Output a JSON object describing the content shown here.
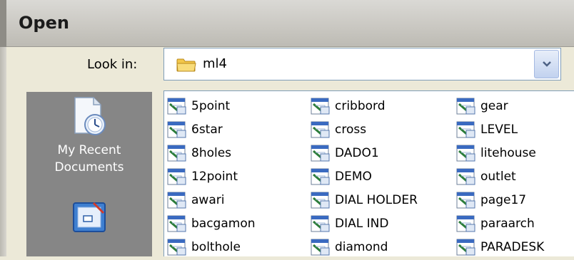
{
  "dialog": {
    "title": "Open"
  },
  "lookin": {
    "label": "Look in:",
    "value": "ml4"
  },
  "places": [
    {
      "line1": "My Recent",
      "line2": "Documents"
    }
  ],
  "files": {
    "columns": [
      [
        "5point",
        "6star",
        "8holes",
        "12point",
        "awari",
        "bacgamon",
        "bolthole"
      ],
      [
        "cribbord",
        "cross",
        "DADO1",
        "DEMO",
        "DIAL HOLDER",
        "DIAL IND",
        "diamond"
      ],
      [
        "gear",
        "LEVEL",
        "litehouse",
        "outlet",
        "page17",
        "paraarch",
        "PARADESK"
      ]
    ]
  },
  "icons": {
    "folder": "folder-icon",
    "file": "file-document-icon",
    "recent": "recent-documents-icon",
    "desktop": "desktop-icon",
    "dropdown": "chevron-down-icon"
  }
}
